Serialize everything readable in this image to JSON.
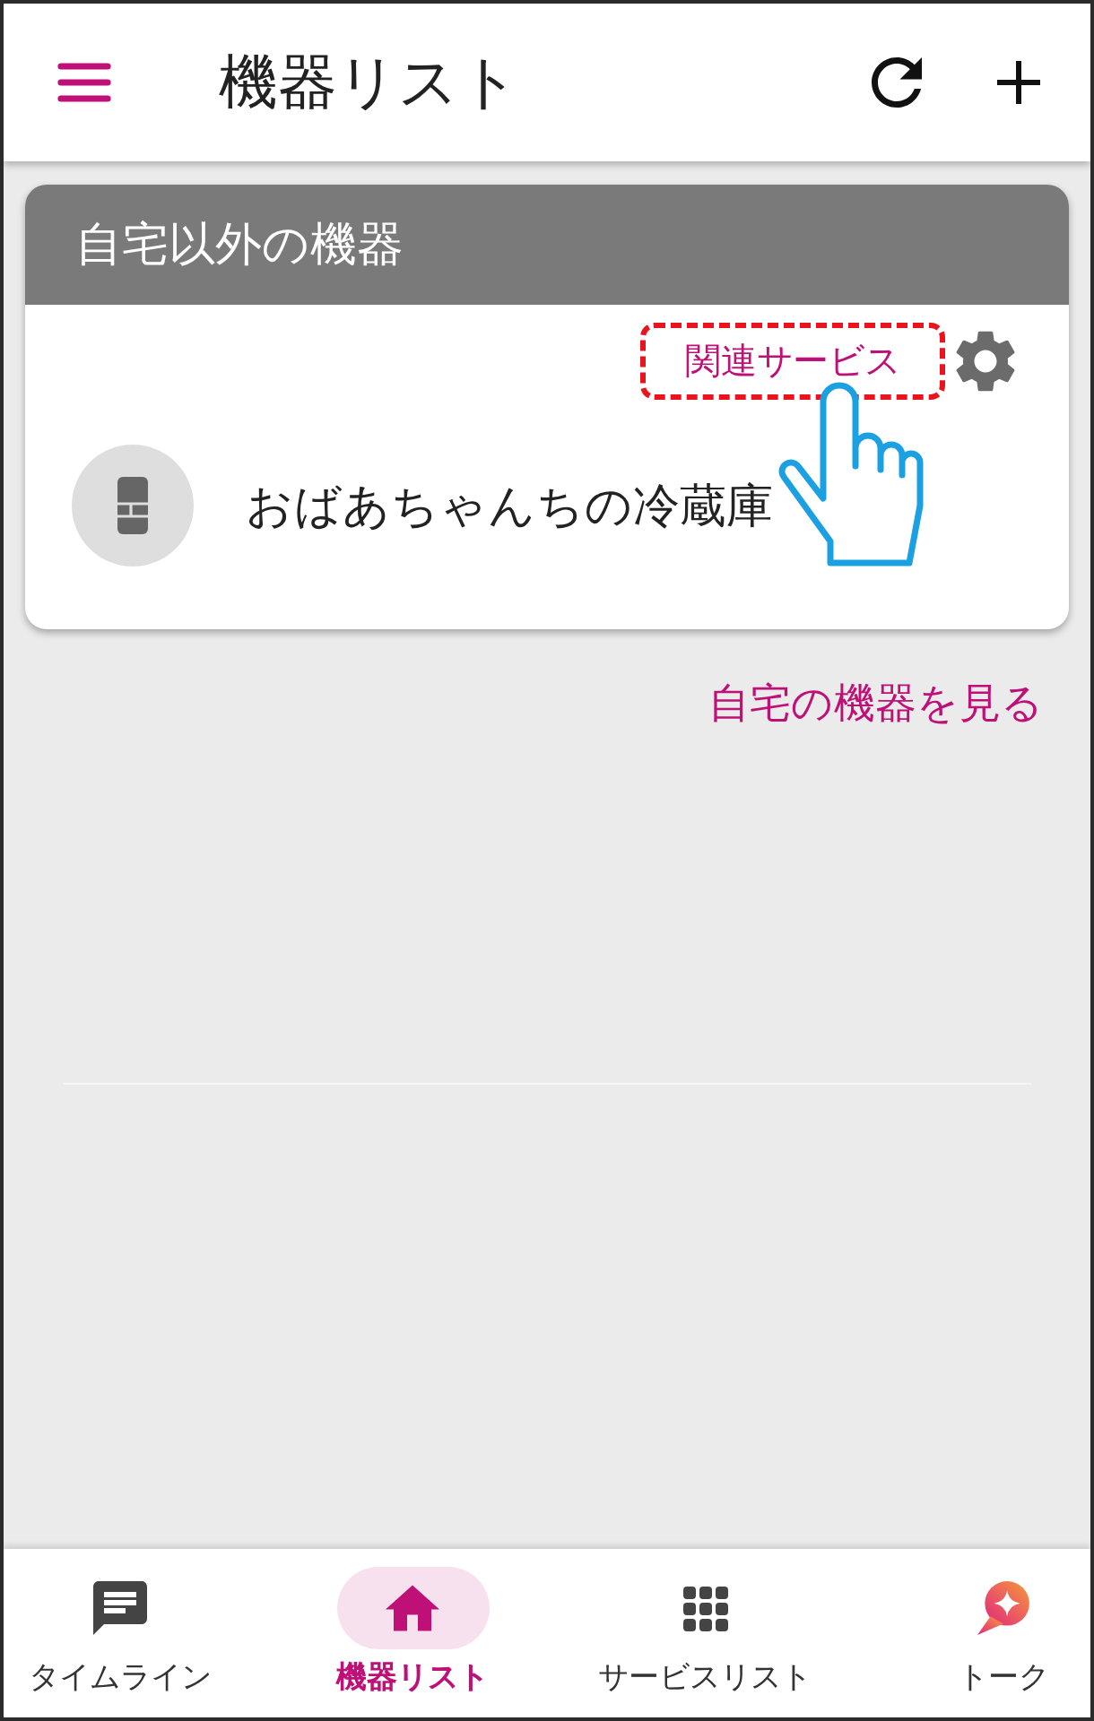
{
  "app_bar": {
    "title": "機器リスト"
  },
  "device_group": {
    "header": "自宅以外の機器",
    "related_services": {
      "label": "関連サービス",
      "highlighted": true
    },
    "devices": [
      {
        "name": "おばあちゃんちの冷蔵庫"
      }
    ]
  },
  "home_devices_link": "自宅の機器を見る",
  "bottom_nav": {
    "items": [
      {
        "label": "タイムライン",
        "selected": false
      },
      {
        "label": "機器リスト",
        "selected": true
      },
      {
        "label": "サービスリスト",
        "selected": false
      },
      {
        "label": "トーク",
        "selected": false
      }
    ]
  }
}
